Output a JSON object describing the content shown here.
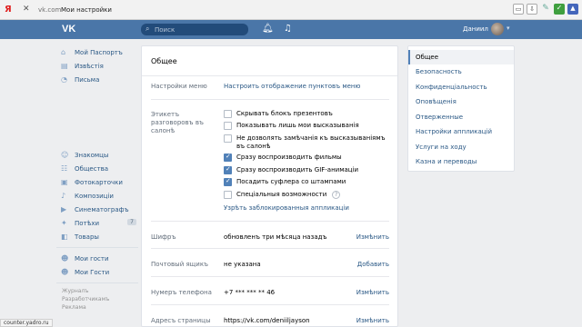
{
  "browser": {
    "brand": "Я",
    "close_glyph": "✕",
    "domain": "vk.com",
    "page_title": "Мои настройки",
    "status_url": "counter.yadro.ru"
  },
  "header": {
    "search_placeholder": "Поиск",
    "user_name": "Даниил"
  },
  "left_nav": {
    "group1": [
      {
        "label": "Мой Паспортъ",
        "icon": "home-icon"
      },
      {
        "label": "Извѣстія",
        "icon": "news-icon"
      },
      {
        "label": "Письма",
        "icon": "messages-icon"
      }
    ],
    "group2": [
      {
        "label": "Знакомцы",
        "icon": "friends-icon"
      },
      {
        "label": "Общества",
        "icon": "groups-icon"
      },
      {
        "label": "Фотокарточки",
        "icon": "photo-icon"
      },
      {
        "label": "Композиціи",
        "icon": "music-icon"
      },
      {
        "label": "Синематографъ",
        "icon": "video-icon"
      },
      {
        "label": "Потѣхи",
        "icon": "games-icon",
        "badge": "7"
      },
      {
        "label": "Товары",
        "icon": "market-icon"
      }
    ],
    "group3": [
      {
        "label": "Мои гости",
        "icon": "guests-icon"
      },
      {
        "label": "Мои Гости",
        "icon": "guests-icon"
      }
    ],
    "footer": [
      "Журналъ",
      "Разработчикамъ",
      "Реклама"
    ]
  },
  "card": {
    "title": "Общее",
    "menu_label": "Настройки меню",
    "menu_link": "Настроить отображение пунктовъ меню",
    "etiquette_label": "Этикетъ разговоровъ въ салонѣ",
    "options": [
      {
        "label": "Скрывать блокъ презентовъ",
        "checked": false
      },
      {
        "label": "Показывать лишь мои высказыванія",
        "checked": false
      },
      {
        "label": "Не дозволять замѣчанія къ высказываніямъ въ салонѣ",
        "checked": false
      },
      {
        "label": "Сразу воспроизводить фильмы",
        "checked": true
      },
      {
        "label": "Сразу воспроизводить GIF-анимаціи",
        "checked": true
      },
      {
        "label": "Посадить суфлера со штампами",
        "checked": true
      },
      {
        "label": "Спеціальныя возможности",
        "checked": false
      }
    ],
    "help_glyph": "?",
    "blocked_apps_link": "Узрѣть заблокированныя аппликаціи",
    "rows": [
      {
        "label": "Шифръ",
        "value": "обновленъ три мѣсяца назадъ",
        "action": "Измѣнить"
      },
      {
        "label": "Почтовый ящикъ",
        "value": "не указана",
        "action": "Добавить"
      },
      {
        "label": "Нумеръ телефона",
        "value": "+7 *** *** ** 46",
        "action": "Измѣнить"
      },
      {
        "label": "Адресъ страницы",
        "value": "https://vk.com/deniiljayson",
        "action": "Измѣнить"
      }
    ]
  },
  "right_menu": [
    {
      "label": "Общее",
      "active": true
    },
    {
      "label": "Безопасность"
    },
    {
      "label": "Конфиденціальность"
    },
    {
      "label": "Оповѣщенія"
    },
    {
      "label": "Отверженные"
    },
    {
      "label": "Настройки аппликацій"
    },
    {
      "label": "Услуги на ходу"
    },
    {
      "label": "Казна и переводы"
    }
  ],
  "colors": {
    "header_blue": "#4a76a8",
    "link_blue": "#2a5885",
    "checkbox_blue": "#5181b8",
    "page_bg": "#edeef0"
  }
}
